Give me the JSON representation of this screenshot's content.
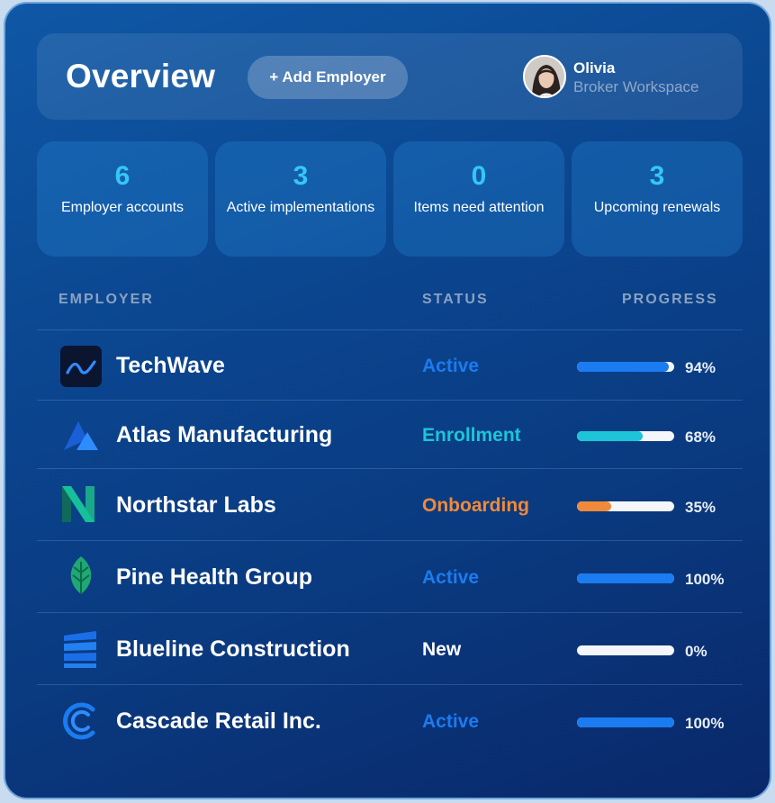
{
  "header": {
    "title": "Overview",
    "add_button": "+ Add Employer",
    "user_name": "Olivia",
    "user_role": "Broker Workspace"
  },
  "stats": [
    {
      "value": "6",
      "label": "Employer accounts"
    },
    {
      "value": "3",
      "label": "Active implementations"
    },
    {
      "value": "0",
      "label": "Items need attention"
    },
    {
      "value": "3",
      "label": "Upcoming renewals"
    }
  ],
  "table": {
    "columns": [
      "EMPLOYER",
      "STATUS",
      "PROGRESS"
    ],
    "rows": [
      {
        "name": "TechWave",
        "logo": "wave-logo-icon",
        "status": "Active",
        "progress": 94,
        "progress_label": "94%"
      },
      {
        "name": "Atlas Manufacturing",
        "logo": "mountain-logo-icon",
        "status": "Enrollment",
        "progress": 68,
        "progress_label": "68%"
      },
      {
        "name": "Northstar Labs",
        "logo": "n-letter-logo-icon",
        "status": "Onboarding",
        "progress": 35,
        "progress_label": "35%"
      },
      {
        "name": "Pine Health Group",
        "logo": "leaf-logo-icon",
        "status": "Active",
        "progress": 100,
        "progress_label": "100%"
      },
      {
        "name": "Blueline Construction",
        "logo": "building-logo-icon",
        "status": "New",
        "progress": 0,
        "progress_label": "0%"
      },
      {
        "name": "Cascade Retail Inc.",
        "logo": "c-letter-logo-icon",
        "status": "Active",
        "progress": 100,
        "progress_label": "100%"
      }
    ]
  },
  "colors": {
    "active": "#1a7cf0",
    "enrollment": "#1ec4d8",
    "onboarding": "#f08a3a",
    "new": "#ffffff",
    "stat_value": "#35c7f5"
  }
}
